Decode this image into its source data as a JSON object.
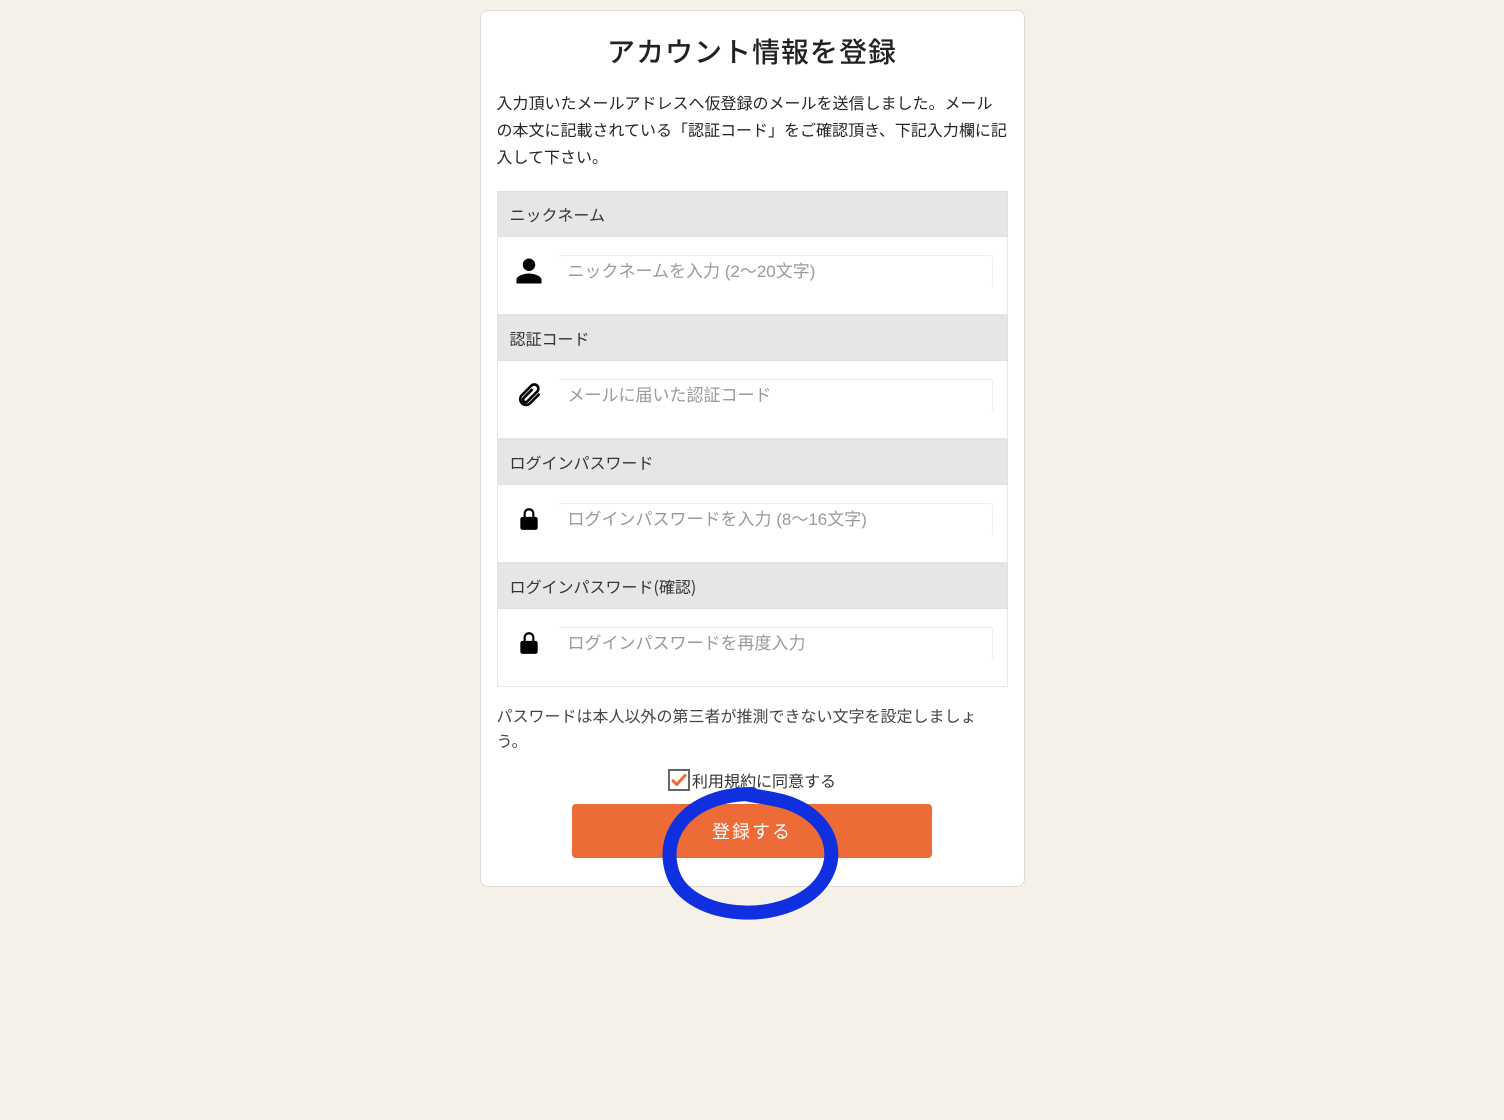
{
  "title": "アカウント情報を登録",
  "instructions": "入力頂いたメールアドレスへ仮登録のメールを送信しました。メールの本文に記載されている「認証コード」をご確認頂き、下記入力欄に記入して下さい。",
  "fields": {
    "nickname": {
      "label": "ニックネーム",
      "placeholder": "ニックネームを入力 (2〜20文字)",
      "value": ""
    },
    "authcode": {
      "label": "認証コード",
      "placeholder": "メールに届いた認証コード",
      "value": ""
    },
    "password": {
      "label": "ログインパスワード",
      "placeholder": "ログインパスワードを入力 (8〜16文字)",
      "value": ""
    },
    "password_confirm": {
      "label": "ログインパスワード(確認)",
      "placeholder": "ログインパスワードを再度入力",
      "value": ""
    }
  },
  "password_note": "パスワードは本人以外の第三者が推測できない文字を設定しましょう。",
  "agreement": {
    "checked": true,
    "label": "利用規約に同意する"
  },
  "submit_label": "登録する",
  "colors": {
    "accent": "#ed6b36",
    "annotation": "#1030e0"
  }
}
